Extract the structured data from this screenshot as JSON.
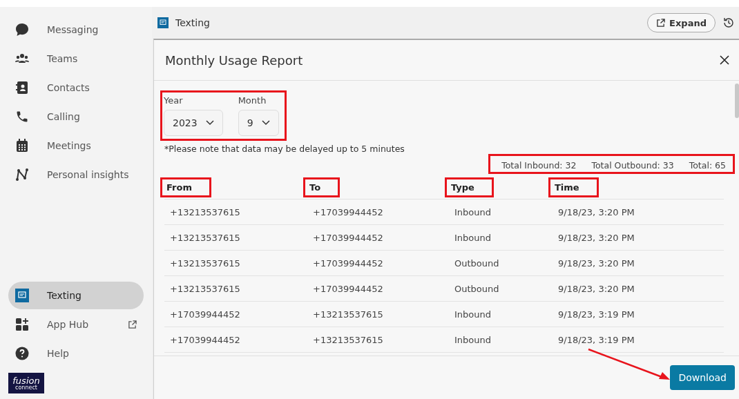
{
  "sidebar": {
    "items": [
      {
        "label": "Messaging",
        "kind": "chat",
        "selected": false
      },
      {
        "label": "Teams",
        "kind": "team",
        "selected": false
      },
      {
        "label": "Contacts",
        "kind": "contacts",
        "selected": false
      },
      {
        "label": "Calling",
        "kind": "phone",
        "selected": false
      },
      {
        "label": "Meetings",
        "kind": "calendar",
        "selected": false
      },
      {
        "label": "Personal insights",
        "kind": "insights",
        "selected": false
      }
    ],
    "bottom_items": [
      {
        "label": "Texting",
        "kind": "texting",
        "selected": true,
        "external": false
      },
      {
        "label": "App Hub",
        "kind": "apps",
        "selected": false,
        "external": true
      },
      {
        "label": "Help",
        "kind": "help",
        "selected": false,
        "external": false
      }
    ],
    "logo": {
      "line1": "fusion",
      "line2": "connect"
    }
  },
  "header": {
    "title": "Texting",
    "expand_button": "Expand"
  },
  "dialog": {
    "title": "Monthly Usage Report",
    "filters": {
      "highlighted": true,
      "fields": [
        {
          "label": "Year",
          "value": "2023"
        },
        {
          "label": "Month",
          "value": "9"
        }
      ]
    },
    "note": "*Please note that data may be delayed up to 5 minutes",
    "totals": {
      "highlighted": true,
      "items": [
        "Total Inbound: 32",
        "Total Outbound: 33",
        "Total: 65"
      ]
    },
    "table": {
      "columns": [
        {
          "label": "From",
          "highlighted": true
        },
        {
          "label": "To",
          "highlighted": true
        },
        {
          "label": "Type",
          "highlighted": true
        },
        {
          "label": "Time",
          "highlighted": true
        }
      ],
      "rows": [
        [
          "+13213537615",
          "+17039944452",
          "Inbound",
          "9/18/23, 3:20 PM"
        ],
        [
          "+13213537615",
          "+17039944452",
          "Inbound",
          "9/18/23, 3:20 PM"
        ],
        [
          "+13213537615",
          "+17039944452",
          "Outbound",
          "9/18/23, 3:20 PM"
        ],
        [
          "+13213537615",
          "+17039944452",
          "Outbound",
          "9/18/23, 3:20 PM"
        ],
        [
          "+17039944452",
          "+13213537615",
          "Inbound",
          "9/18/23, 3:19 PM"
        ],
        [
          "+17039944452",
          "+13213537615",
          "Inbound",
          "9/18/23, 3:19 PM"
        ]
      ]
    },
    "download_button": {
      "label": "Download",
      "pointed_by_arrow": true
    }
  }
}
